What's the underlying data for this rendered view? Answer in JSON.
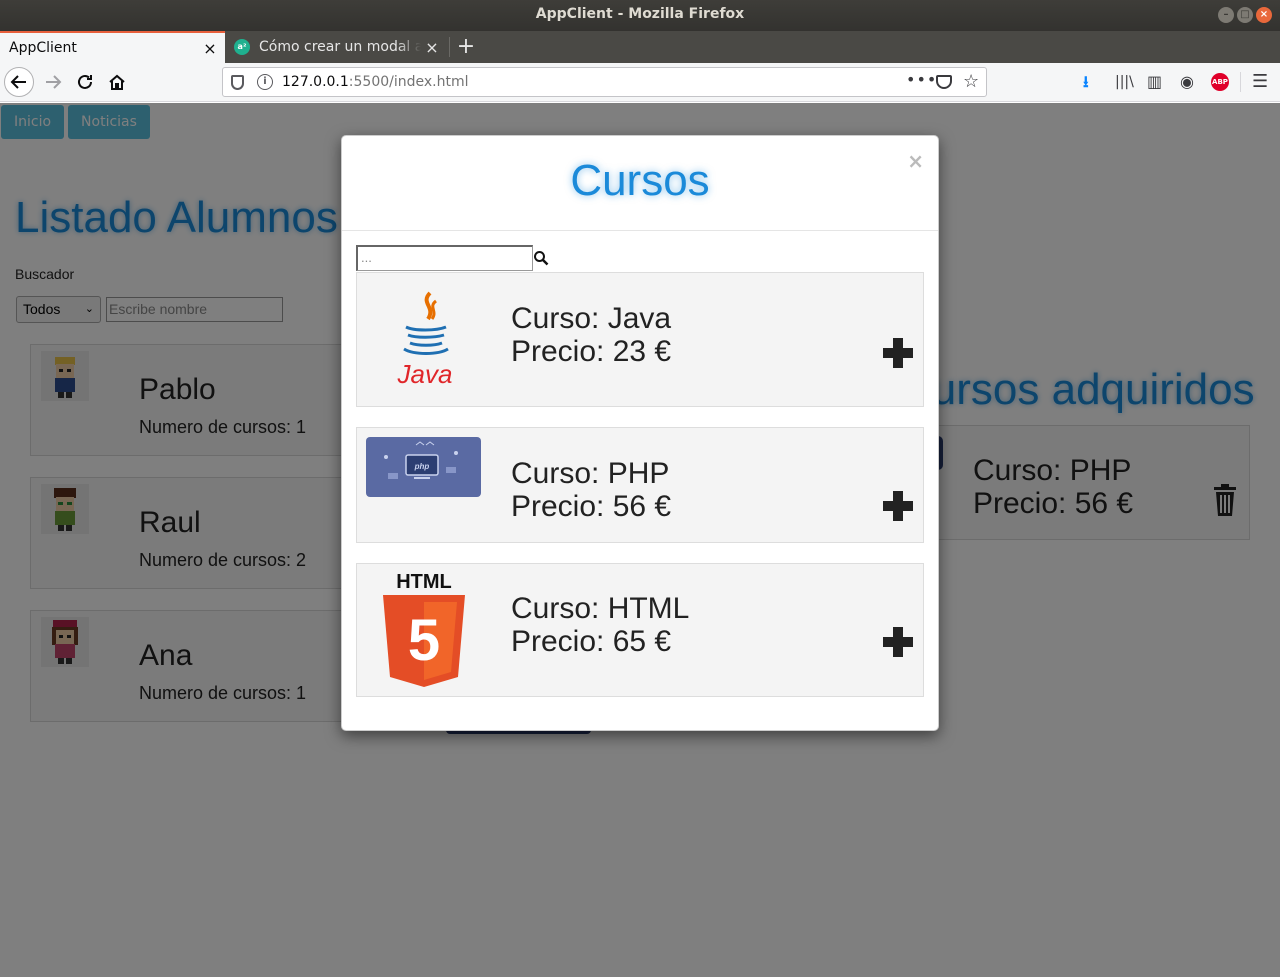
{
  "window": {
    "title": "AppClient - Mozilla Firefox"
  },
  "tabs": [
    {
      "label": "AppClient",
      "close": "×"
    },
    {
      "label": "Cómo crear un modal a p",
      "close": "×"
    }
  ],
  "new_tab": "+",
  "url": {
    "host": "127.0.0.1",
    "rest": ":5500/index.html"
  },
  "page": {
    "nav": [
      "Inicio",
      "Noticias"
    ],
    "heading": "Listado Alumnos",
    "heading_right": "Cursos adquiridos",
    "search_label": "Buscador",
    "filter_value": "Todos",
    "name_placeholder": "Escribe nombre",
    "students": [
      {
        "name": "Pablo",
        "count": "Numero de cursos: 1"
      },
      {
        "name": "Raul",
        "count": "Numero de cursos: 2"
      },
      {
        "name": "Ana",
        "count": "Numero de cursos: 1"
      }
    ],
    "acquired": [
      {
        "course": "Curso: PHP",
        "price": "Precio: 56 €"
      }
    ]
  },
  "modal": {
    "title": "Cursos",
    "close": "×",
    "search_placeholder": "...",
    "courses": [
      {
        "course": "Curso: Java",
        "price": "Precio: 23 €",
        "logo": "java-logo"
      },
      {
        "course": "Curso: PHP",
        "price": "Precio: 56 €",
        "logo": "php-logo"
      },
      {
        "course": "Curso: HTML",
        "price": "Precio: 65 €",
        "logo": "html5-logo",
        "logo_text": "HTML",
        "logo_badge": "5"
      }
    ],
    "logo_java_text": "Java",
    "logo_php_text": "php"
  },
  "colors": {
    "accent": "#1b8ad9",
    "nav_button": "#5bc0de",
    "html5": "#e44d26"
  }
}
